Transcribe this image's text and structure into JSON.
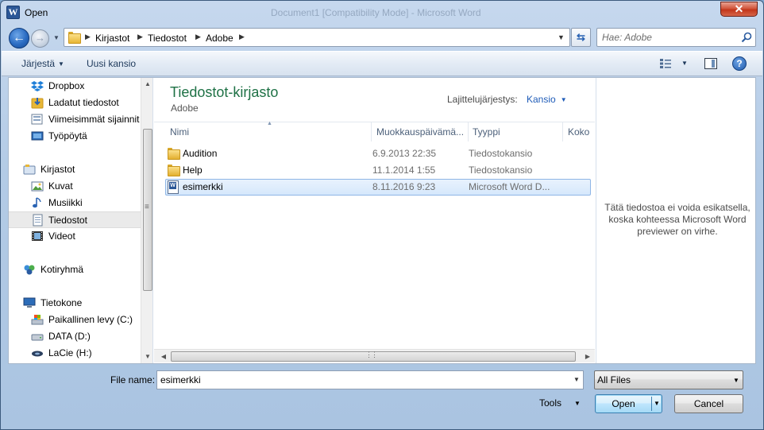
{
  "window": {
    "title": "Open",
    "app_icon_letter": "W",
    "background_title": "Document1 [Compatibility Mode] - Microsoft Word",
    "close_glyph": "✕"
  },
  "address_bar": {
    "breadcrumbs": [
      "Kirjastot",
      "Tiedostot",
      "Adobe"
    ],
    "search_placeholder": "Hae: Adobe"
  },
  "toolbar": {
    "organize_label": "Järjestä",
    "new_folder_label": "Uusi kansio",
    "help_glyph": "?"
  },
  "nav": {
    "favorites": [
      {
        "label": "Dropbox",
        "icon": "dropbox-icon"
      },
      {
        "label": "Ladatut tiedostot",
        "icon": "downloads-icon"
      },
      {
        "label": "Viimeisimmät sijainnit",
        "icon": "recent-places-icon"
      },
      {
        "label": "Työpöytä",
        "icon": "desktop-icon"
      }
    ],
    "libraries_header": "Kirjastot",
    "libraries": [
      {
        "label": "Kuvat",
        "icon": "pictures-icon"
      },
      {
        "label": "Musiikki",
        "icon": "music-icon"
      },
      {
        "label": "Tiedostot",
        "icon": "documents-icon",
        "selected": true
      },
      {
        "label": "Videot",
        "icon": "videos-icon"
      }
    ],
    "homegroup": "Kotiryhmä",
    "computer_header": "Tietokone",
    "drives": [
      {
        "label": "Paikallinen levy (C:)",
        "icon": "local-disk-icon"
      },
      {
        "label": "DATA (D:)",
        "icon": "drive-icon"
      },
      {
        "label": "LaCie (H:)",
        "icon": "external-drive-icon"
      }
    ]
  },
  "library": {
    "title": "Tiedostot-kirjasto",
    "subtitle": "Adobe",
    "arrange_label": "Lajittelujärjestys:",
    "arrange_value": "Kansio"
  },
  "columns": {
    "name": "Nimi",
    "date": "Muokkauspäivämä...",
    "type": "Tyyppi",
    "size": "Koko"
  },
  "files": [
    {
      "name": "Audition",
      "date": "6.9.2013 22:35",
      "type": "Tiedostokansio",
      "kind": "folder"
    },
    {
      "name": "Help",
      "date": "11.1.2014 1:55",
      "type": "Tiedostokansio",
      "kind": "folder"
    },
    {
      "name": "esimerkki",
      "date": "8.11.2016 9:23",
      "type": "Microsoft Word D...",
      "kind": "word",
      "selected": true
    }
  ],
  "preview": {
    "message": "Tätä tiedostoa ei voida esikatsella, koska kohteessa Microsoft Word previewer on virhe."
  },
  "footer": {
    "filename_label": "File name:",
    "filename_value": "esimerkki",
    "filetype_value": "All Files",
    "tools_label": "Tools",
    "open_label": "Open",
    "cancel_label": "Cancel"
  },
  "colors": {
    "library_title": "#1e7145",
    "link_blue": "#1f5cb8",
    "selection": "#d6e8fc"
  }
}
